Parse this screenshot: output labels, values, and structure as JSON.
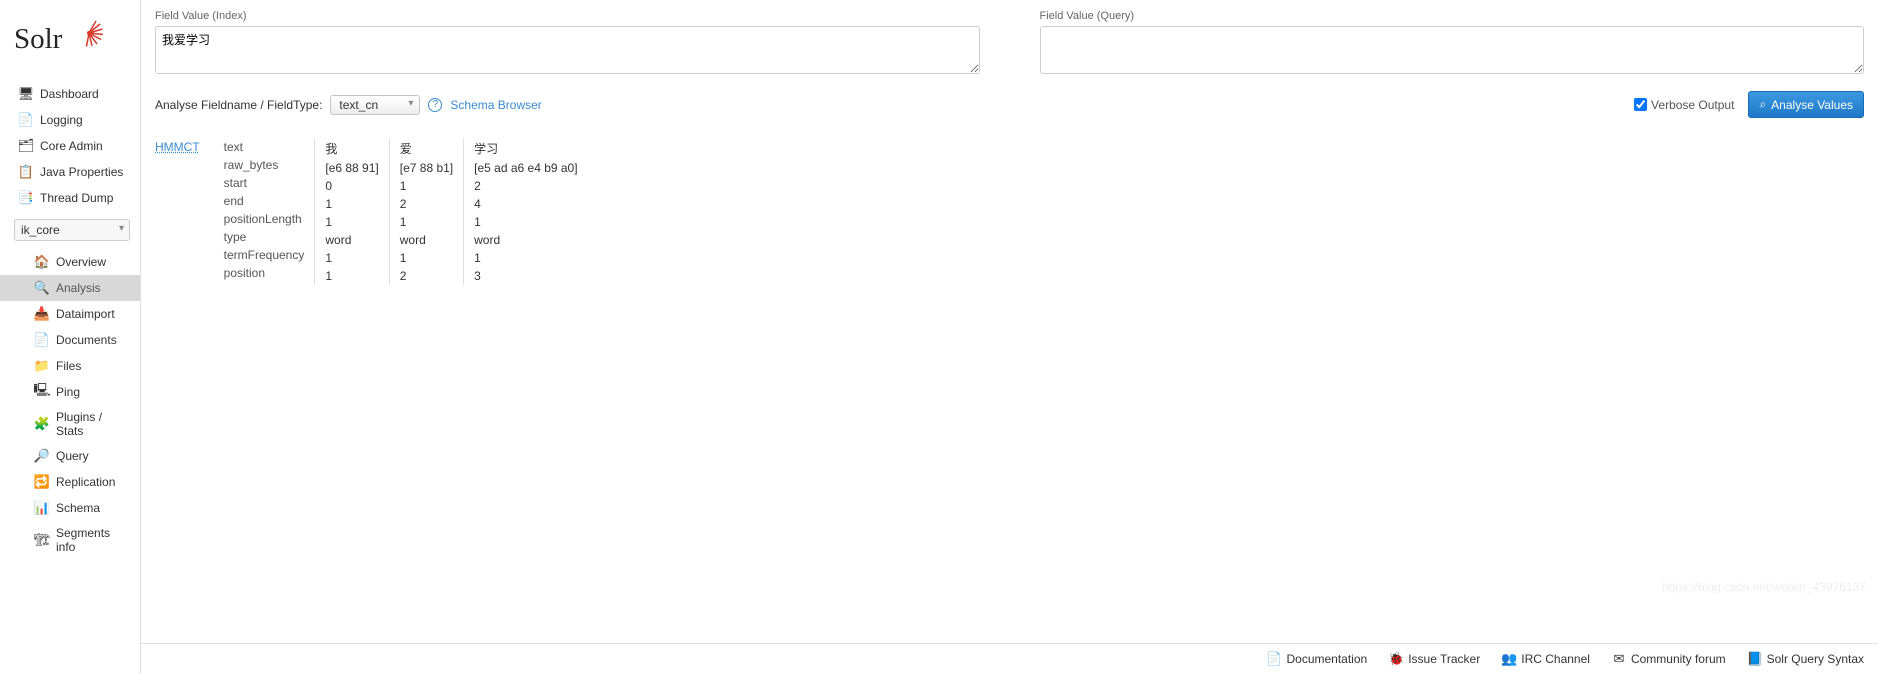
{
  "logo": {
    "text": "Solr"
  },
  "sidebar": {
    "main": [
      {
        "label": "Dashboard",
        "icon": "🖥"
      },
      {
        "label": "Logging",
        "icon": "📄"
      },
      {
        "label": "Core Admin",
        "icon": "🗂"
      },
      {
        "label": "Java Properties",
        "icon": "📋"
      },
      {
        "label": "Thread Dump",
        "icon": "📑"
      }
    ],
    "core_selected": "ik_core",
    "core": [
      {
        "label": "Overview",
        "icon": "🏠"
      },
      {
        "label": "Analysis",
        "icon": "🔍",
        "active": true
      },
      {
        "label": "Dataimport",
        "icon": "📥"
      },
      {
        "label": "Documents",
        "icon": "📄"
      },
      {
        "label": "Files",
        "icon": "📁"
      },
      {
        "label": "Ping",
        "icon": "🖳"
      },
      {
        "label": "Plugins / Stats",
        "icon": "🧩"
      },
      {
        "label": "Query",
        "icon": "🔎"
      },
      {
        "label": "Replication",
        "icon": "🔁"
      },
      {
        "label": "Schema",
        "icon": "📊"
      },
      {
        "label": "Segments info",
        "icon": "🏗"
      }
    ]
  },
  "form": {
    "index_label": "Field Value (Index)",
    "index_value": "我爱学习",
    "query_label": "Field Value (Query)",
    "query_value": "",
    "analyse_label": "Analyse Fieldname / FieldType:",
    "fieldtype": "text_cn",
    "schema_browser": "Schema Browser",
    "verbose_label": "Verbose Output",
    "verbose_checked": true,
    "analyse_btn": "Analyse Values"
  },
  "analysis": {
    "analyzer": "HMMCT",
    "rows": [
      "text",
      "raw_bytes",
      "start",
      "end",
      "positionLength",
      "type",
      "termFrequency",
      "position"
    ],
    "tokens": [
      {
        "values": [
          "我",
          "[e6 88 91]",
          "0",
          "1",
          "1",
          "word",
          "1",
          "1"
        ]
      },
      {
        "values": [
          "爱",
          "[e7 88 b1]",
          "1",
          "2",
          "1",
          "word",
          "1",
          "2"
        ]
      },
      {
        "values": [
          "学习",
          "[e5 ad a6 e4 b9 a0]",
          "2",
          "4",
          "1",
          "word",
          "1",
          "3"
        ]
      }
    ]
  },
  "footer": {
    "links": [
      {
        "label": "Documentation",
        "icon": "📄"
      },
      {
        "label": "Issue Tracker",
        "icon": "🐞"
      },
      {
        "label": "IRC Channel",
        "icon": "👥"
      },
      {
        "label": "Community forum",
        "icon": "✉"
      },
      {
        "label": "Solr Query Syntax",
        "icon": "📘"
      }
    ]
  },
  "watermark": "https://blog.csdn.net/weixin_43976137"
}
